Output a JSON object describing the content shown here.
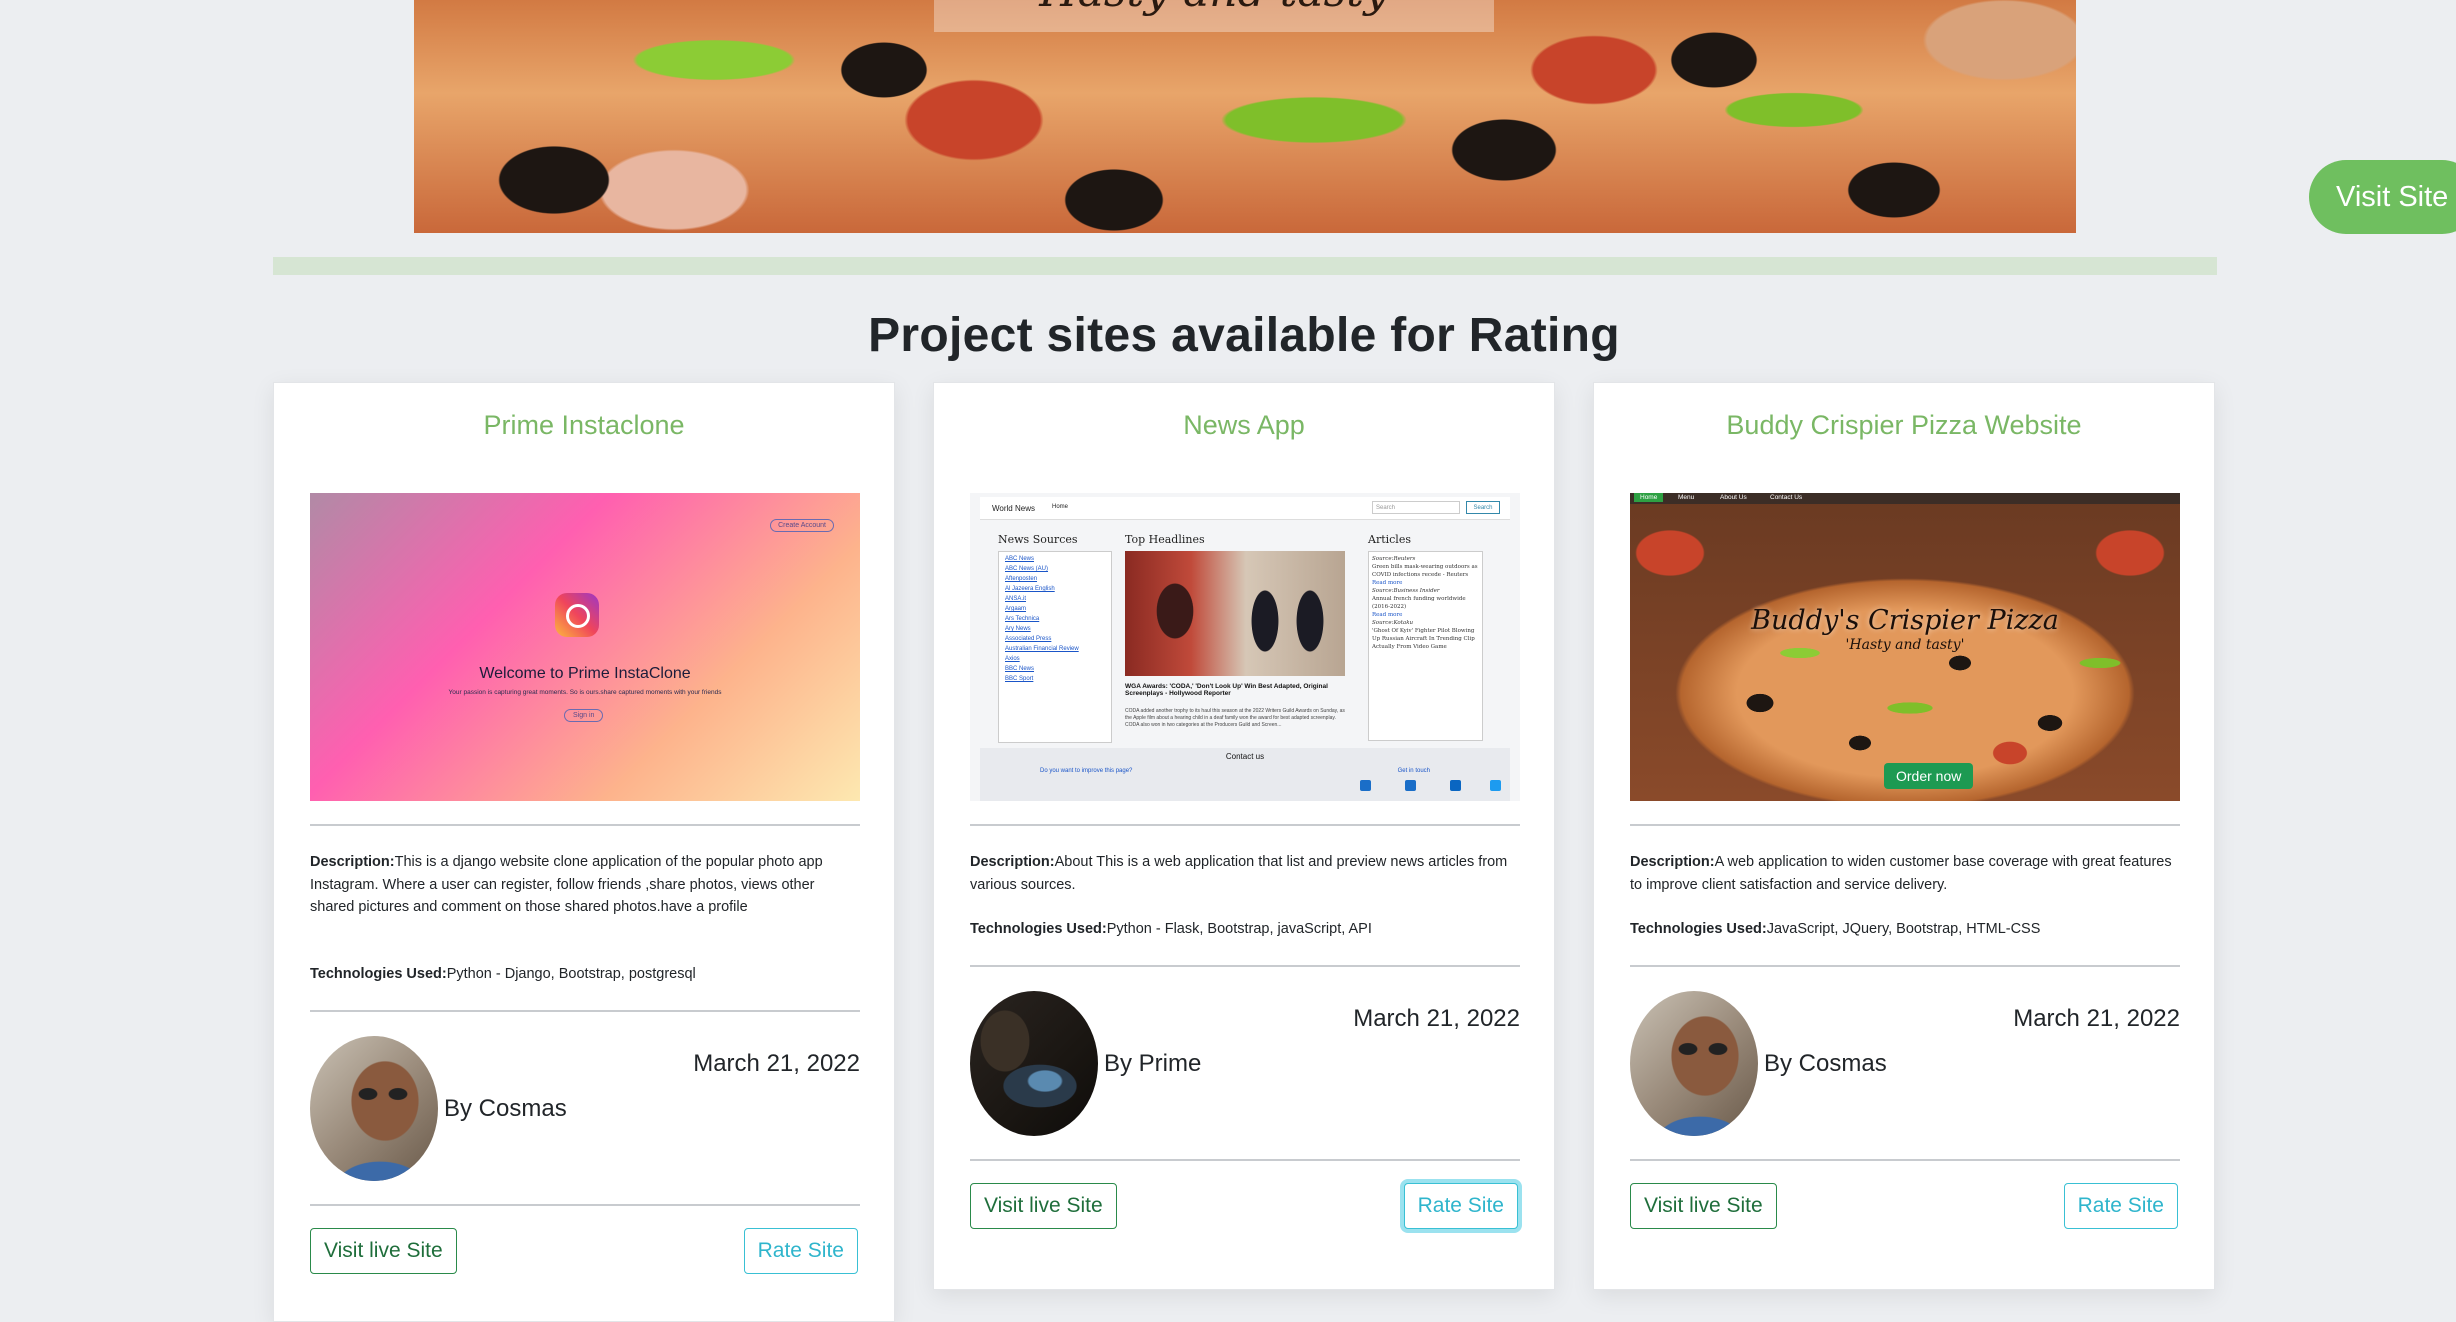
{
  "hero": {
    "caption": "Hasty and tasty",
    "visit_label": "Visit Site"
  },
  "section": {
    "title": "Project sites available for Rating"
  },
  "labels": {
    "description": "Description:",
    "technologies": "Technologies Used:",
    "visit_button": "Visit live Site",
    "rate_button": "Rate Site"
  },
  "colors": {
    "accent_green": "#6fbf5f",
    "card_title": "#7ab765",
    "visit_border": "#2a8a4a",
    "rate_border": "#39c0d4",
    "page_bg": "#eceef1"
  },
  "projects": [
    {
      "title": "Prime Instaclone",
      "description": "This is a django website clone application of the popular photo app Instagram. Where a user can register, follow friends ,share photos, views other shared pictures and comment on those shared photos.have a profile",
      "technologies": "Python - Django, Bootstrap, postgresql",
      "author": "By Cosmas",
      "date": "March 21, 2022",
      "preview": {
        "create_account": "Create Account",
        "welcome": "Welcome to Prime InstaClone",
        "subtitle": "Your passion is capturing great moments. So is ours.share captured moments with your friends",
        "sign_in": "Sign in"
      }
    },
    {
      "title": "News App",
      "description": "About This is a web application that list and preview news articles from various sources.",
      "technologies": "Python - Flask, Bootstrap, javaScript, API",
      "author": "By Prime",
      "date": "March 21, 2022",
      "preview": {
        "brand": "World News",
        "home": "Home",
        "search_placeholder": "Search",
        "search_button": "Search",
        "sources_heading": "News Sources",
        "headlines_heading": "Top Headlines",
        "articles_heading": "Articles",
        "sources": [
          "ABC News",
          "ABC News (AU)",
          "Aftenposten",
          "Al Jazeera English",
          "ANSA.it",
          "Argaam",
          "Ars Technica",
          "Ary News",
          "Associated Press",
          "Australian Financial Review",
          "Axios",
          "BBC News",
          "BBC Sport"
        ],
        "headline": "WGA Awards: 'CODA,' 'Don't Look Up' Win Best Adapted, Original Screenplays - Hollywood Reporter",
        "headline_body": "CODA added another trophy to its haul this season at the 2022 Writers Guild Awards on Sunday, as the Apple film about a hearing child in a deaf family won the award for best adapted screenplay. CODA also won in two categories at the Producers Guild and Screen...",
        "articles": [
          "Source:Reuters",
          "Green bills mask-wearing outdoors as COVID infections recede - Reuters",
          "Read more",
          "Source:Business Insider",
          "Annual french funding worldwide (2016-2022)",
          "Read more",
          "Source:Kotaku",
          "'Ghost Of Kyiv' Fighter Pilot Blowing Up Russian Aircraft In Trending Clip Actually From Video Game"
        ],
        "contact": "Contact us",
        "improve": "Do you want to improve this page?",
        "touch": "Get in touch"
      }
    },
    {
      "title": "Buddy Crispier Pizza Website",
      "description": "A web application to widen customer base coverage with great features to improve client satisfaction and service delivery.",
      "technologies": "JavaScript, JQuery, Bootstrap, HTML-CSS",
      "author": "By Cosmas",
      "date": "March 21, 2022",
      "preview": {
        "nav": [
          "Home",
          "Menu",
          "About Us",
          "Contact Us"
        ],
        "brand": "Buddy's Crispier Pizza",
        "tagline": "'Hasty and tasty'",
        "order": "Order now"
      }
    }
  ]
}
